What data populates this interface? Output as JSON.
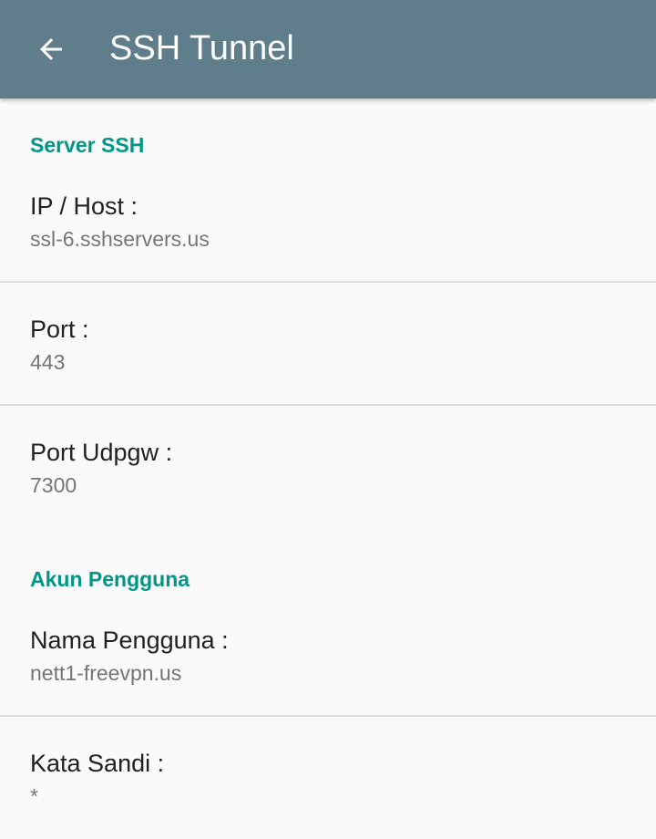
{
  "appbar": {
    "title": "SSH Tunnel",
    "back_icon": "arrow-left-icon",
    "color": "#607d8b"
  },
  "accent_color": "#009688",
  "sections": {
    "server": {
      "header": "Server SSH",
      "host": {
        "title": "IP / Host :",
        "value": "ssl-6.sshservers.us"
      },
      "port": {
        "title": "Port :",
        "value": "443"
      },
      "udpgw": {
        "title": "Port Udpgw :",
        "value": "7300"
      }
    },
    "account": {
      "header": "Akun Pengguna",
      "username": {
        "title": "Nama Pengguna :",
        "value": "nett1-freevpn.us"
      },
      "password": {
        "title": "Kata Sandi :",
        "value": "*"
      }
    }
  }
}
